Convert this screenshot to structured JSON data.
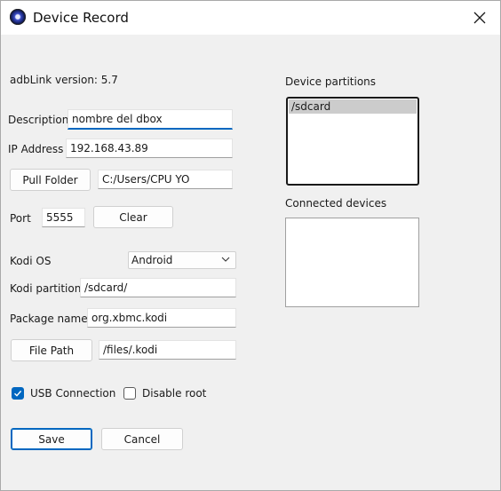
{
  "window": {
    "title": "Device Record",
    "icon": "app-icon",
    "close_icon": "close-icon"
  },
  "info": {
    "version_label": "adbLink version: 5.7"
  },
  "form": {
    "description_label": "Description",
    "description_value": "nombre del dbox",
    "ip_label": "IP Address",
    "ip_value": "192.168.43.89",
    "pull_folder_label": "Pull Folder",
    "pull_folder_value": "C:/Users/CPU YO",
    "port_label": "Port",
    "port_value": "5555",
    "clear_label": "Clear",
    "kodi_os_label": "Kodi OS",
    "kodi_os_value": "Android",
    "kodi_partition_label": "Kodi partition",
    "kodi_partition_value": "/sdcard/",
    "package_name_label": "Package name",
    "package_name_value": "org.xbmc.kodi",
    "file_path_label": "File Path",
    "file_path_value": "/files/.kodi"
  },
  "options": {
    "usb_connection_label": "USB Connection",
    "usb_connection_checked": true,
    "disable_root_label": "Disable root",
    "disable_root_checked": false
  },
  "actions": {
    "save_label": "Save",
    "cancel_label": "Cancel"
  },
  "partitions": {
    "label": "Device partitions",
    "items": [
      "/sdcard"
    ]
  },
  "connected": {
    "label": "Connected devices",
    "items": []
  },
  "colors": {
    "accent": "#0067c0",
    "selection": "#cccccc",
    "window_bg": "#f0f0f0"
  }
}
